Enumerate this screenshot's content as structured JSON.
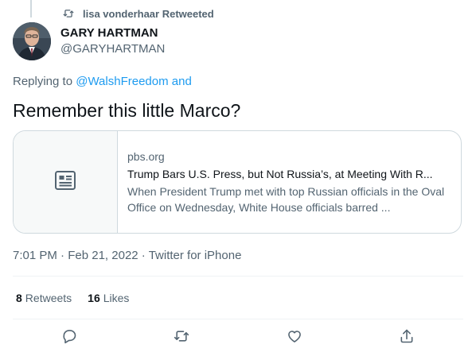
{
  "retweet_context": {
    "icon": "retweet-icon",
    "text": "lisa vonderhaar Retweeted"
  },
  "author": {
    "avatar_icon": "avatar",
    "display_name": "GARY HARTMAN",
    "handle": "@GARYHARTMAN"
  },
  "reply": {
    "prefix": "Replying to ",
    "mention": "@WalshFreedom",
    "suffix": " and"
  },
  "tweet": {
    "text": "Remember this little Marco?"
  },
  "link_card": {
    "thumb_icon": "article-icon",
    "domain": "pbs.org",
    "title": "Trump Bars U.S. Press, but Not Russia’s, at Meeting With R...",
    "description": "When President Trump met with top Russian officials in the Oval Office on Wednesday, White House officials barred ..."
  },
  "meta": {
    "time": "7:01 PM",
    "separator": " · ",
    "date": "Feb 21, 2022",
    "source": "Twitter for iPhone"
  },
  "stats": {
    "retweets_count": "8",
    "retweets_label": "Retweets",
    "likes_count": "16",
    "likes_label": "Likes"
  },
  "actions": [
    {
      "icon": "reply-icon"
    },
    {
      "icon": "retweet-icon"
    },
    {
      "icon": "like-icon"
    },
    {
      "icon": "share-icon"
    }
  ],
  "colors": {
    "text_primary": "#0f1419",
    "text_secondary": "#536471",
    "link": "#1d9bf0",
    "border": "#cfd9de"
  }
}
